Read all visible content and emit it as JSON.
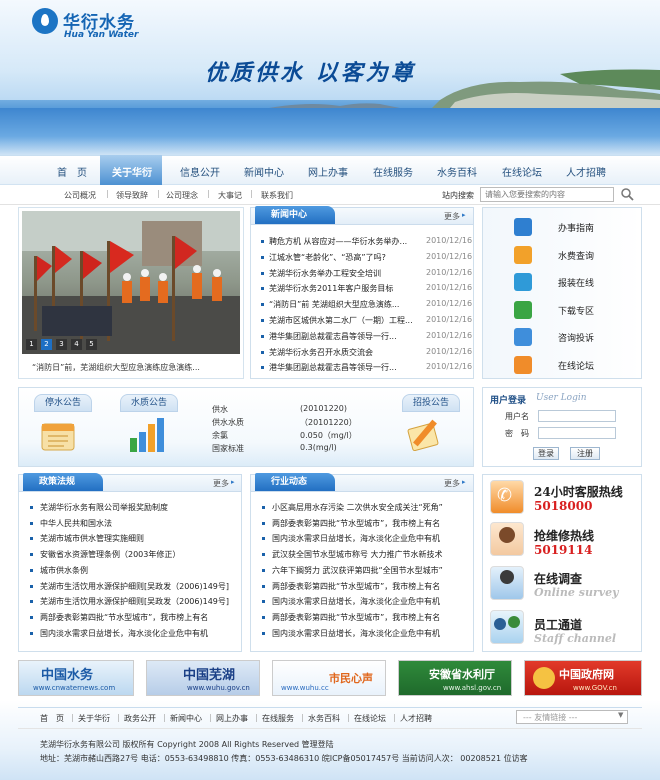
{
  "brand": {
    "name_cn": "华衍水务",
    "name_en": "Hua Yan Water",
    "slogan": "优质供水 以客为尊"
  },
  "nav": {
    "items": [
      "首　页",
      "关于华衍",
      "信息公开",
      "新闻中心",
      "网上办事",
      "在线服务",
      "水务百科",
      "在线论坛",
      "人才招聘"
    ],
    "active_index": 1
  },
  "subnav": {
    "items": [
      "公司概况",
      "领导致辞",
      "公司理念",
      "大事记",
      "联系我们"
    ]
  },
  "search": {
    "label": "站内搜索",
    "placeholder": "请输入您要搜索的内容"
  },
  "photo": {
    "caption": "“消防日”前，芜湖组织大型应急演练应急演练...",
    "pages": [
      "1",
      "2",
      "3",
      "4",
      "5"
    ],
    "active_page": 1
  },
  "news": {
    "title": "新闻中心",
    "more": "更多",
    "items": [
      {
        "text": "聘危方机 从容应对——华衍水务举办...",
        "date": "2010/12/16"
      },
      {
        "text": "江城水管“老龄化”、“恐高”了吗?",
        "date": "2010/12/16"
      },
      {
        "text": "芜湖华衍水务举办工程安全培训",
        "date": "2010/12/16"
      },
      {
        "text": "芜湖华衍水务2011年客户服务目标",
        "date": "2010/12/16"
      },
      {
        "text": "“消防日”前 芜湖组织大型应急演练...",
        "date": "2010/12/16"
      },
      {
        "text": "芜湖市区城供水第二水厂（一期）工程...",
        "date": "2010/12/16"
      },
      {
        "text": "港华集团副总裁霍志昌等领导一行...",
        "date": "2010/12/16"
      },
      {
        "text": "芜湖华衍水务召开水质交流会",
        "date": "2010/12/16"
      },
      {
        "text": "港华集团副总裁霍志昌等领导一行...",
        "date": "2010/12/16"
      }
    ]
  },
  "services": {
    "items": [
      "办事指南",
      "水费查询",
      "报装在线",
      "下载专区",
      "咨询投诉",
      "在线论坛"
    ]
  },
  "notices": {
    "tab1": "停水公告",
    "tab2": "水质公告",
    "tab3": "招投公告",
    "water_quality": [
      {
        "label": "供水",
        "value": "(20101220)"
      },
      {
        "label": "供水水质",
        "value": "（20101220）"
      },
      {
        "label": "余氯",
        "value": "0.050（mg/l）"
      },
      {
        "label": "国家标准",
        "value": "0.3(mg/l)"
      }
    ]
  },
  "login": {
    "title": "用户登录",
    "title_en": "User Login",
    "user_label": "用户名",
    "pass_label": "密　码",
    "login_btn": "登录",
    "register_btn": "注册"
  },
  "policy": {
    "title": "政策法规",
    "more": "更多",
    "items": [
      "芜湖华衍水务有限公司举报奖励制度",
      "中华人民共和国水法",
      "芜湖市城市供水管理实施细则",
      "安徽省水资源管理条例（2003年修正）",
      "城市供水条例",
      "芜湖市生活饮用水源保护细则[吴政发（2006)149号]",
      "芜湖市生活饮用水源保护细则[吴政发（2006)149号]",
      "两部委表彰第四批“节水型城市”，我市榜上有名",
      "国内淡水需求日益增长，海水淡化企业危中有机"
    ]
  },
  "industry": {
    "title": "行业动态",
    "more": "更多",
    "items": [
      "小区高层用水存污染 二次供水安全成关注“死角”",
      "两部委表彰第四批“节水型城市”，我市榜上有名",
      "国内淡水需求日益增长，海水淡化企业危中有机",
      "武汉获全国节水型城市称号 大力推广节水新技术",
      "六年下搁努力 武汉获评第四批“全国节水型城市”",
      "两部委表彰第四批“节水型城市”，我市榜上有名",
      "国内淡水需求日益增长，海水淡化企业危中有机",
      "两部委表彰第四批“节水型城市”，我市榜上有名",
      "国内淡水需求日益增长，海水淡化企业危中有机"
    ]
  },
  "hotline": {
    "service_title": "24小时客服热线",
    "service_num": "5018000",
    "repair_title": "抢维修热线",
    "repair_num": "5019114",
    "survey_title": "在线调查",
    "survey_en": "Online survey",
    "staff_title": "员工通道",
    "staff_en": "Staff channel"
  },
  "banners": [
    {
      "label": "中国水务",
      "sub": "www.cnwaternews.com"
    },
    {
      "label": "中国芜湖",
      "sub": "www.wuhu.gov.cn"
    },
    {
      "label": "市民心声",
      "sub": "www.wuhu.cc"
    },
    {
      "label": "安徽省水利厅",
      "sub": "www.ahsl.gov.cn"
    },
    {
      "label": "中国政府网",
      "sub": "www.GOV.cn"
    }
  ],
  "footer": {
    "nav": [
      "首　页",
      "关于华衍",
      "政务公开",
      "新闻中心",
      "网上办事",
      "在线服务",
      "水务百科",
      "在线论坛",
      "人才招聘"
    ],
    "links_placeholder": "--- 友情链接 ---",
    "copyright": "芜湖华衍水务有限公司   版权所有 Copyright 2008 All Rights Reserved 管理登陆",
    "address": "地址：芜湖市赭山西路27号  电话：0553-63498810  传真：0553-63486310  皖ICP备05017457号   当前访问人次： 00208521  位访客"
  },
  "colors": {
    "brand_blue": "#1565b4",
    "hotline_red": "#d81f1f",
    "nav_text": "#24507e"
  }
}
